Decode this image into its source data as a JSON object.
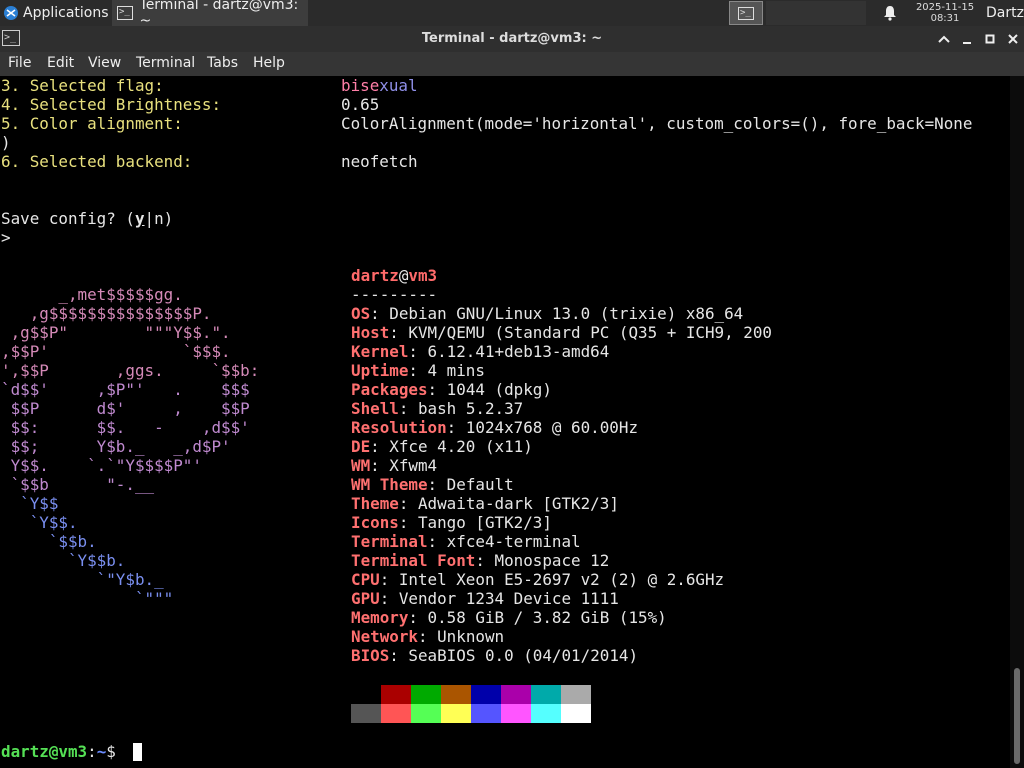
{
  "panel": {
    "apps_label": "Applications",
    "task_label": "Terminal - dartz@vm3: ~",
    "clock_date": "2025-11-15",
    "clock_time": "08:31",
    "user": "Dartz"
  },
  "window": {
    "title": "Terminal - dartz@vm3: ~",
    "icon_glyph": ">_"
  },
  "menu": [
    "File",
    "Edit",
    "View",
    "Terminal",
    "Tabs",
    "Help"
  ],
  "config": {
    "flag_label": "3. Selected flag:",
    "flag_value_a": "bise",
    "flag_value_b": "xual",
    "brightness_label": "4. Selected Brightness:",
    "brightness_value": "0.65",
    "alignment_label": "5. Color alignment:",
    "alignment_value": "ColorAlignment(mode='horizontal', custom_colors=(), fore_back=None",
    "alignment_cont": ")",
    "backend_label": "6. Selected backend:",
    "backend_value": "neofetch",
    "save_prompt_pre": "Save config? (",
    "save_prompt_y": "y",
    "save_prompt_post": "|n)",
    "input_prompt": ">"
  },
  "logo_lines": [
    "      _,met$$$$$gg.",
    "   ,g$$$$$$$$$$$$$$$P.",
    " ,g$$P\"        \"\"\"Y$$.\".",
    ",$$P'              `$$$.",
    "',$$P       ,ggs.     `$$b:",
    "`d$$'     ,$P\"'   .    $$$",
    " $$P      d$'     ,    $$P",
    " $$:      $$.   -    ,d$$'",
    " $$;      Y$b._   _,d$P'",
    " Y$$.    `.`\"Y$$$$P\"'",
    " `$$b      \"-.__",
    "  `Y$$",
    "   `Y$$.",
    "     `$$b.",
    "       `Y$$b.",
    "          `\"Y$b._",
    "              `\"\"\""
  ],
  "sysinfo": {
    "user": "dartz",
    "at": "@",
    "host": "vm3",
    "separator": "---------",
    "rows": [
      {
        "label": "OS",
        "value": ": Debian GNU/Linux 13.0 (trixie) x86_64"
      },
      {
        "label": "Host",
        "value": ": KVM/QEMU (Standard PC (Q35 + ICH9, 200"
      },
      {
        "label": "Kernel",
        "value": ": 6.12.41+deb13-amd64"
      },
      {
        "label": "Uptime",
        "value": ": 4 mins"
      },
      {
        "label": "Packages",
        "value": ": 1044 (dpkg)"
      },
      {
        "label": "Shell",
        "value": ": bash 5.2.37"
      },
      {
        "label": "Resolution",
        "value": ": 1024x768 @ 60.00Hz"
      },
      {
        "label": "DE",
        "value": ": Xfce 4.20 (x11)"
      },
      {
        "label": "WM",
        "value": ": Xfwm4"
      },
      {
        "label": "WM Theme",
        "value": ": Default"
      },
      {
        "label": "Theme",
        "value": ": Adwaita-dark [GTK2/3]"
      },
      {
        "label": "Icons",
        "value": ": Tango [GTK2/3]"
      },
      {
        "label": "Terminal",
        "value": ": xfce4-terminal"
      },
      {
        "label": "Terminal Font",
        "value": ": Monospace 12"
      },
      {
        "label": "CPU",
        "value": ": Intel Xeon E5-2697 v2 (2) @ 2.6GHz"
      },
      {
        "label": "GPU",
        "value": ": Vendor 1234 Device 1111"
      },
      {
        "label": "Memory",
        "value": ": 0.58 GiB / 3.82 GiB (15%)"
      },
      {
        "label": "Network",
        "value": ": Unknown"
      },
      {
        "label": "BIOS",
        "value": ": SeaBIOS 0.0 (04/01/2014)"
      }
    ]
  },
  "palette": {
    "normal": [
      "#000000",
      "#aa0000",
      "#00aa00",
      "#aa5500",
      "#0000aa",
      "#aa00aa",
      "#00aaaa",
      "#aaaaaa"
    ],
    "bright": [
      "#555555",
      "#ff5555",
      "#55ff55",
      "#ffff55",
      "#5555ff",
      "#ff55ff",
      "#55ffff",
      "#ffffff"
    ]
  },
  "prompt": {
    "user_host": "dartz@vm3",
    "colon": ":",
    "path": "~",
    "symbol": "$ "
  }
}
